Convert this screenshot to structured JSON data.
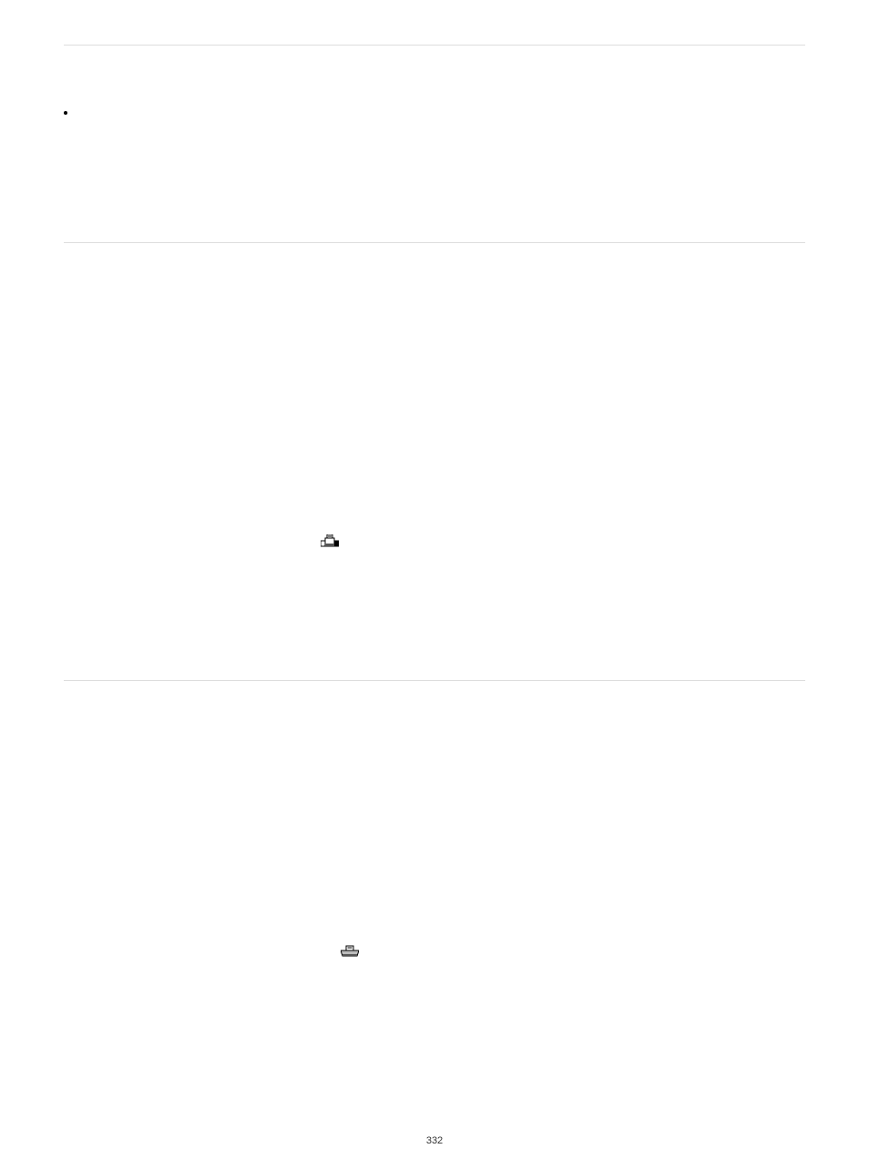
{
  "page_number": "332",
  "icon1_name": "fax-device-icon",
  "icon2_name": "mail-tray-icon"
}
